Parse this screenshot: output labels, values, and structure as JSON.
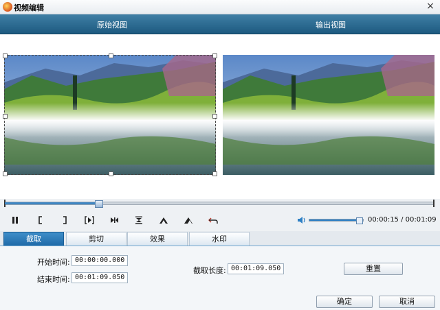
{
  "window": {
    "title": "视频编辑",
    "close_glyph": "×"
  },
  "views": {
    "original": "原始视图",
    "output": "输出视图"
  },
  "playback": {
    "progress": 0.218,
    "volume": 0.92,
    "current_time": "00:00:15",
    "separator": " / ",
    "total_time": "00:01:09",
    "controls": [
      "pause-icon",
      "set-start-bracket-icon",
      "set-end-bracket-icon",
      "frame-step-icon",
      "skip-to-end-icon",
      "flip-vertical-icon",
      "rotate-left-icon",
      "rotate-right-icon",
      "undo-icon"
    ]
  },
  "tabs": [
    {
      "label": "截取",
      "active": true
    },
    {
      "label": "剪切",
      "active": false
    },
    {
      "label": "效果",
      "active": false
    },
    {
      "label": "水印",
      "active": false
    }
  ],
  "trim": {
    "start_label": "开始时间:",
    "start_value": "00:00:00.000",
    "end_label": "结束时间:",
    "end_value": "00:01:09.050",
    "length_label": "截取长度:",
    "length_value": "00:01:09.050",
    "reset_label": "重置"
  },
  "footer": {
    "ok_label": "确定",
    "cancel_label": "取消"
  },
  "colors": {
    "accent": "#1f6aa8",
    "header_bar": "#2a6a92"
  }
}
